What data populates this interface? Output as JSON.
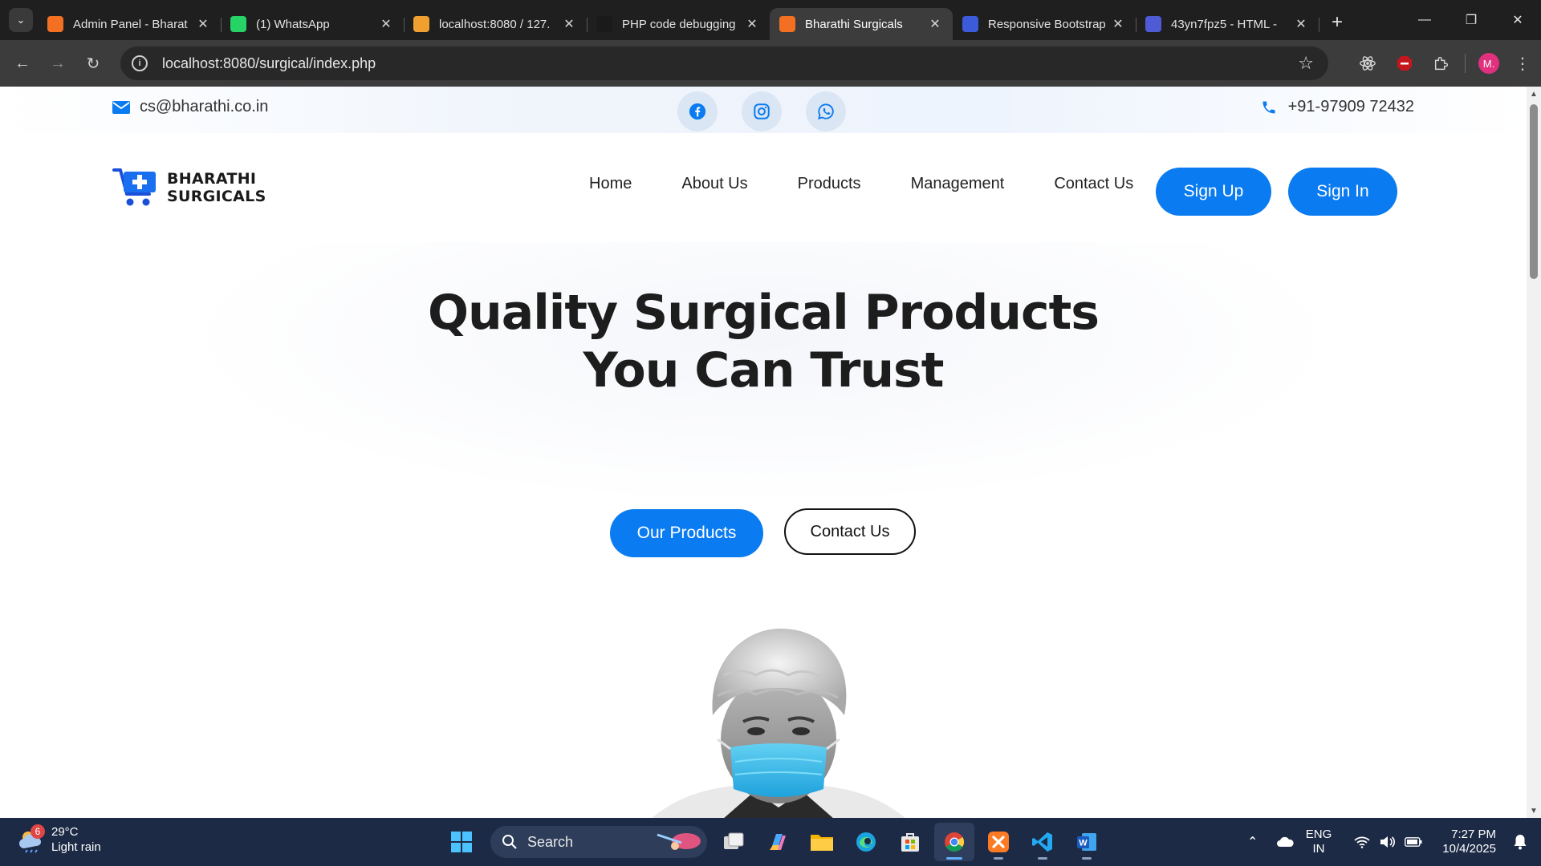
{
  "browser": {
    "tabs": [
      {
        "label": "Admin Panel - Bharat",
        "favicon": "xampp-icon",
        "color": "#f36f22",
        "active": false
      },
      {
        "label": "(1) WhatsApp",
        "favicon": "whatsapp-icon",
        "color": "#25d366",
        "active": false
      },
      {
        "label": "localhost:8080 / 127.",
        "favicon": "phpmyadmin-icon",
        "color": "#f0a030",
        "active": false
      },
      {
        "label": "PHP code debugging",
        "favicon": "chatgpt-icon",
        "color": "#1a1a1a",
        "active": false
      },
      {
        "label": "Bharathi Surgicals",
        "favicon": "xampp-icon",
        "color": "#f36f22",
        "active": true
      },
      {
        "label": "Responsive Bootstrap",
        "favicon": "bootstrap-icon",
        "color": "#3b5bdb",
        "active": false
      },
      {
        "label": "43yn7fpz5 - HTML - ",
        "favicon": "code-icon",
        "color": "#4f5bd5",
        "active": false
      }
    ],
    "url": "localhost:8080/surgical/index.php",
    "profile_initial": "M."
  },
  "topbar": {
    "email": "cs@bharathi.co.in",
    "phone": "+91-97909 72432",
    "social_icons": [
      "facebook-icon",
      "instagram-icon",
      "whatsapp-icon"
    ]
  },
  "header": {
    "logo_line1": "BHARATHI",
    "logo_line2": "SURGICALS",
    "nav": [
      "Home",
      "About Us",
      "Products",
      "Management",
      "Contact Us"
    ],
    "signup_label": "Sign Up",
    "signin_label": "Sign In"
  },
  "hero": {
    "title_line1": "Quality Surgical Products",
    "title_line2": "You Can Trust",
    "primary_cta": "Our Products",
    "secondary_cta": "Contact Us"
  },
  "taskbar": {
    "weather_temp": "29°C",
    "weather_desc": "Light rain",
    "weather_badge": "6",
    "search_label": "Search",
    "lang_line1": "ENG",
    "lang_line2": "IN",
    "time": "7:27 PM",
    "date": "10/4/2025"
  },
  "colors": {
    "accent": "#0a7bf0",
    "chrome_dark": "#1f1f1f",
    "taskbar": "#1c2a45"
  }
}
